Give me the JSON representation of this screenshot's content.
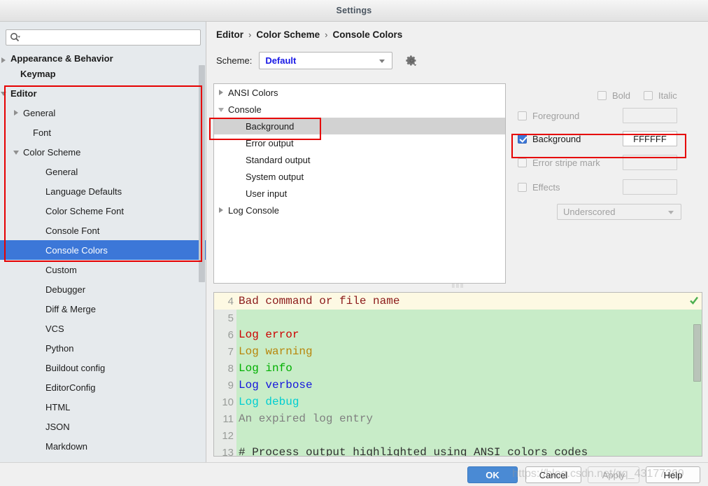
{
  "window": {
    "title": "Settings"
  },
  "sidebar": {
    "search": {
      "value": "",
      "placeholder": "",
      "icon": "search-icon"
    },
    "items": [
      {
        "label": "Appearance & Behavior",
        "twisty": "right",
        "indent": 10,
        "bold": true,
        "selected": false,
        "clipped": true
      },
      {
        "label": "Keymap",
        "twisty": "none",
        "indent": 24,
        "bold": true,
        "selected": false
      },
      {
        "label": "Editor",
        "twisty": "down",
        "indent": 10,
        "bold": true,
        "selected": false
      },
      {
        "label": "General",
        "twisty": "right",
        "indent": 28,
        "bold": false,
        "selected": false
      },
      {
        "label": "Font",
        "twisty": "none",
        "indent": 42,
        "bold": false,
        "selected": false
      },
      {
        "label": "Color Scheme",
        "twisty": "down",
        "indent": 28,
        "bold": false,
        "selected": false
      },
      {
        "label": "General",
        "twisty": "none",
        "indent": 60,
        "bold": false,
        "selected": false
      },
      {
        "label": "Language Defaults",
        "twisty": "none",
        "indent": 60,
        "bold": false,
        "selected": false
      },
      {
        "label": "Color Scheme Font",
        "twisty": "none",
        "indent": 60,
        "bold": false,
        "selected": false
      },
      {
        "label": "Console Font",
        "twisty": "none",
        "indent": 60,
        "bold": false,
        "selected": false
      },
      {
        "label": "Console Colors",
        "twisty": "none",
        "indent": 60,
        "bold": false,
        "selected": true
      },
      {
        "label": "Custom",
        "twisty": "none",
        "indent": 60,
        "bold": false,
        "selected": false
      },
      {
        "label": "Debugger",
        "twisty": "none",
        "indent": 60,
        "bold": false,
        "selected": false
      },
      {
        "label": "Diff & Merge",
        "twisty": "none",
        "indent": 60,
        "bold": false,
        "selected": false
      },
      {
        "label": "VCS",
        "twisty": "none",
        "indent": 60,
        "bold": false,
        "selected": false
      },
      {
        "label": "Python",
        "twisty": "none",
        "indent": 60,
        "bold": false,
        "selected": false
      },
      {
        "label": "Buildout config",
        "twisty": "none",
        "indent": 60,
        "bold": false,
        "selected": false
      },
      {
        "label": "EditorConfig",
        "twisty": "none",
        "indent": 60,
        "bold": false,
        "selected": false
      },
      {
        "label": "HTML",
        "twisty": "none",
        "indent": 60,
        "bold": false,
        "selected": false
      },
      {
        "label": "JSON",
        "twisty": "none",
        "indent": 60,
        "bold": false,
        "selected": false
      },
      {
        "label": "Markdown",
        "twisty": "none",
        "indent": 60,
        "bold": false,
        "selected": false
      }
    ]
  },
  "content": {
    "breadcrumb": {
      "parts": [
        "Editor",
        "Color Scheme",
        "Console Colors"
      ],
      "separator": "›"
    },
    "scheme": {
      "label": "Scheme:",
      "value": "Default",
      "value_color": "#1919E6",
      "gear_icon": "gear-icon",
      "dropdown_icon": "chevron-down-icon"
    },
    "option_tree": [
      {
        "label": "ANSI Colors",
        "twisty": "right",
        "child": false,
        "highlighted": false
      },
      {
        "label": "Console",
        "twisty": "down",
        "child": false,
        "highlighted": false
      },
      {
        "label": "Background",
        "twisty": "none",
        "child": true,
        "highlighted": true
      },
      {
        "label": "Error output",
        "twisty": "none",
        "child": true,
        "highlighted": false
      },
      {
        "label": "Standard output",
        "twisty": "none",
        "child": true,
        "highlighted": false
      },
      {
        "label": "System output",
        "twisty": "none",
        "child": true,
        "highlighted": false
      },
      {
        "label": "User input",
        "twisty": "none",
        "child": true,
        "highlighted": false
      },
      {
        "label": "Log Console",
        "twisty": "right",
        "child": false,
        "highlighted": false
      }
    ],
    "properties": {
      "bold": {
        "label": "Bold",
        "checked": false,
        "enabled": false
      },
      "italic": {
        "label": "Italic",
        "checked": false,
        "enabled": false
      },
      "foreground": {
        "label": "Foreground",
        "checked": false,
        "enabled": false,
        "value": ""
      },
      "background": {
        "label": "Background",
        "checked": true,
        "enabled": true,
        "value": "FFFFFF"
      },
      "error_stripe_mark": {
        "label": "Error stripe mark",
        "checked": false,
        "enabled": false,
        "value": ""
      },
      "effects": {
        "label": "Effects",
        "checked": false,
        "enabled": false,
        "value": ""
      },
      "effect_type": {
        "value": "Underscored",
        "enabled": false
      }
    },
    "preview": {
      "background_color": "#C8ECC8",
      "caret_row_color": "#FDF9E3",
      "lines": [
        {
          "num": "4",
          "text": "Bad command or file name",
          "color": "#8B1A1A",
          "caret": true
        },
        {
          "num": "5",
          "text": "",
          "color": "#303030",
          "caret": false
        },
        {
          "num": "6",
          "text": "Log error",
          "color": "#CC0000",
          "caret": false
        },
        {
          "num": "7",
          "text": "Log warning",
          "color": "#B8860B",
          "caret": false
        },
        {
          "num": "8",
          "text": "Log info",
          "color": "#00B000",
          "caret": false
        },
        {
          "num": "9",
          "text": "Log verbose",
          "color": "#1515DD",
          "caret": false
        },
        {
          "num": "10",
          "text": "Log debug",
          "color": "#00CED1",
          "caret": false
        },
        {
          "num": "11",
          "text": "An expired log entry",
          "color": "#808080",
          "caret": false
        },
        {
          "num": "12",
          "text": "",
          "color": "#303030",
          "caret": false
        },
        {
          "num": "13",
          "text": "# Process output highlighted using ANSI colors codes",
          "color": "#303030",
          "caret": false
        }
      ],
      "check_icon": "checkmark-icon"
    }
  },
  "buttons": {
    "ok": {
      "label": "OK",
      "primary": true,
      "enabled": true
    },
    "cancel": {
      "label": "Cancel",
      "primary": false,
      "enabled": true
    },
    "apply": {
      "label": "Apply",
      "primary": false,
      "enabled": false
    },
    "help": {
      "label": "Help",
      "primary": false,
      "enabled": true
    }
  },
  "watermark": {
    "text": "https://blog.csdn.net/qq_43177369"
  },
  "annotations": {
    "color": "#E60000"
  }
}
